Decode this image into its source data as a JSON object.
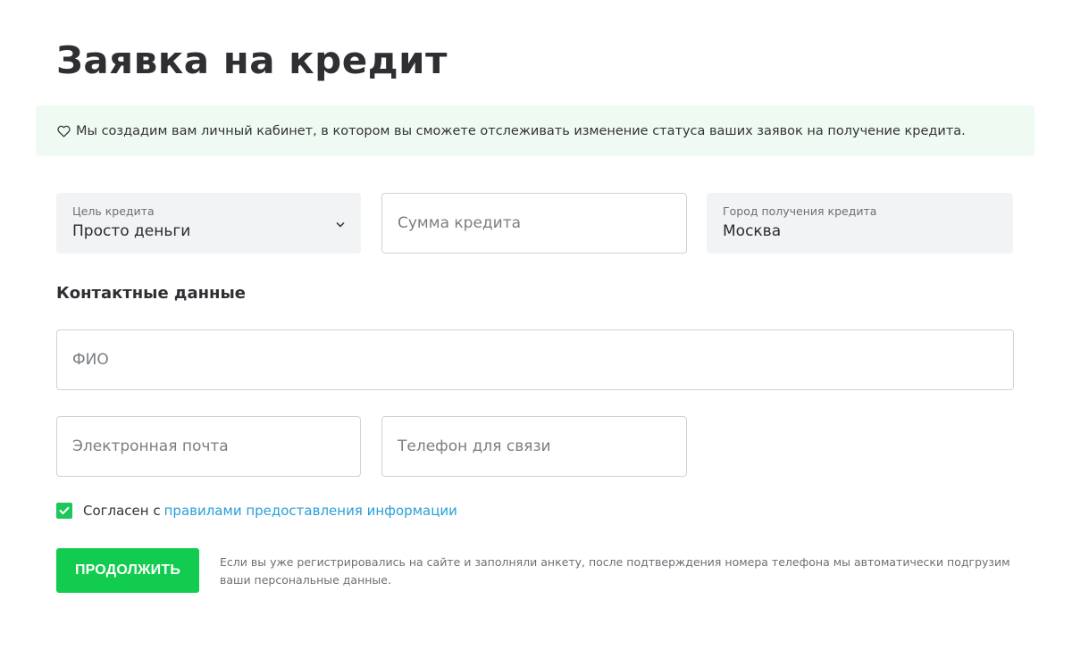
{
  "page": {
    "title": "Заявка на кредит"
  },
  "notice": {
    "icon": "heart-icon",
    "text": "Мы создадим вам личный кабинет, в котором вы сможете отслеживать изменение статуса ваших заявок на получение кредита."
  },
  "loan": {
    "purpose": {
      "label": "Цель кредита",
      "value": "Просто деньги"
    },
    "amount": {
      "placeholder": "Сумма кредита"
    },
    "city": {
      "label": "Город получения кредита",
      "value": "Москва"
    }
  },
  "contacts": {
    "title": "Контактные данные",
    "fio": {
      "placeholder": "ФИО"
    },
    "email": {
      "placeholder": "Электронная почта"
    },
    "phone": {
      "placeholder": "Телефон для связи"
    }
  },
  "agreement": {
    "checked": true,
    "text": "Согласен с",
    "link": "правилами предоставления информации"
  },
  "submit": {
    "label": "ПРОДОЛЖИТЬ",
    "hint": "Если вы уже регистрировались на сайте и заполняли анкету, после подтверждения номера телефона мы автоматически подгрузим ваши персональные данные."
  },
  "colors": {
    "accent": "#12cc4f",
    "link": "#2a9fd8",
    "notice_bg": "#effbf2",
    "field_bg": "#f2f3f5"
  }
}
